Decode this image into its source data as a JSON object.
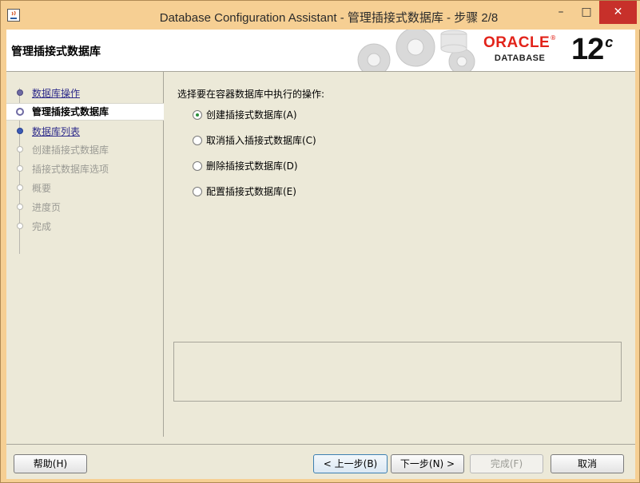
{
  "window": {
    "title": "Database Configuration Assistant - 管理插接式数据库 - 步骤 2/8",
    "minimize": "–",
    "maximize": "□",
    "close": "✕"
  },
  "header": {
    "title": "管理插接式数据库",
    "oracle": "ORACLE",
    "registered": "®",
    "database": "DATABASE",
    "version": "12",
    "version_suffix": "c"
  },
  "steps": [
    {
      "label": "数据库操作",
      "state": "done"
    },
    {
      "label": "管理插接式数据库",
      "state": "current"
    },
    {
      "label": "数据库列表",
      "state": "next"
    },
    {
      "label": "创建插接式数据库",
      "state": "disabled"
    },
    {
      "label": "插接式数据库选项",
      "state": "disabled"
    },
    {
      "label": "概要",
      "state": "disabled"
    },
    {
      "label": "进度页",
      "state": "disabled"
    },
    {
      "label": "完成",
      "state": "disabled"
    }
  ],
  "content": {
    "prompt": "选择要在容器数据库中执行的操作:",
    "options": [
      {
        "label": "创建插接式数据库(A)",
        "checked": true
      },
      {
        "label": "取消插入插接式数据库(C)",
        "checked": false
      },
      {
        "label": "删除插接式数据库(D)",
        "checked": false
      },
      {
        "label": "配置插接式数据库(E)",
        "checked": false
      }
    ]
  },
  "buttons": {
    "help": "帮助(H)",
    "back": "< 上一步(B)",
    "next": "下一步(N) >",
    "finish": "完成(F)",
    "cancel": "取消"
  },
  "colors": {
    "oracle_red": "#e2231a",
    "title_bar": "#f6cf93",
    "dialog_bg": "#ece9d8",
    "close_red": "#c7302a"
  }
}
